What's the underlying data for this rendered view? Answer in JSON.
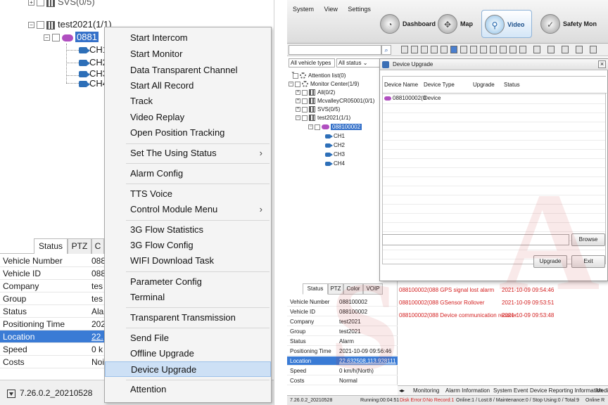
{
  "left": {
    "tree": {
      "top_partial": "SVS(0/5)",
      "group": "test2021(1/1)",
      "device": "0881",
      "channels": [
        "CH1",
        "CH2",
        "CH3",
        "CH4"
      ]
    },
    "context_menu": {
      "items": [
        "Start Intercom",
        "Start Monitor",
        "Data Transparent Channel",
        "Start All Record",
        "Track",
        "Video Replay",
        "Open Position Tracking",
        "Set The Using Status",
        "Alarm Config",
        "TTS Voice",
        "Control Module Menu",
        "3G Flow Statistics",
        "3G Flow Config",
        "WIFI Download Task",
        "Parameter Config",
        "Terminal",
        "Transparent Transmission",
        "Send File",
        "Offline Upgrade",
        "Device Upgrade",
        "Attention"
      ],
      "highlighted": "Device Upgrade",
      "submenu_arrow": "›"
    },
    "status_tabs": [
      "Status",
      "PTZ",
      "C"
    ],
    "status_rows": [
      {
        "k": "Vehicle Number",
        "v": "088"
      },
      {
        "k": "Vehicle ID",
        "v": "088"
      },
      {
        "k": "Company",
        "v": "tes"
      },
      {
        "k": "Group",
        "v": "tes"
      },
      {
        "k": "Status",
        "v": "Ala"
      },
      {
        "k": "Positioning Time",
        "v": "202"
      },
      {
        "k": "Location",
        "v": "22."
      },
      {
        "k": "Speed",
        "v": "0 k"
      },
      {
        "k": "Costs",
        "v": "Noi"
      }
    ],
    "version": "7.26.0.2_20210528"
  },
  "right": {
    "menu": [
      "System",
      "View",
      "Settings"
    ],
    "nav": [
      {
        "label": "Dashboard",
        "icon": "◔"
      },
      {
        "label": "Map",
        "icon": "✥"
      },
      {
        "label": "Video",
        "icon": "⚲"
      },
      {
        "label": "Safety Mon",
        "icon": "✓"
      }
    ],
    "filter": {
      "vehicle_types": "All vehicle types",
      "status": "All status"
    },
    "tree": {
      "items": [
        "Attention list(0)",
        "Monitor Center(1/9)",
        "All(0/2)",
        "McvalleyCR05001(0/1)",
        "SVS(0/5)",
        "test2021(1/1)",
        "088100002",
        "CH1",
        "CH2",
        "CH3",
        "CH4"
      ]
    },
    "dialog": {
      "title": "Device Upgrade",
      "close": "×",
      "columns": [
        "Device Name",
        "Device Type",
        "Upgrade",
        "Status"
      ],
      "row": {
        "name": "088100002(0",
        "type": "Device"
      },
      "browse": "Browse",
      "upgrade": "Upgrade",
      "exit": "Exit"
    },
    "status_tabs": [
      "Status",
      "PTZ",
      "Color",
      "VOIP"
    ],
    "status_rows": [
      {
        "k": "Vehicle Number",
        "v": "088100002"
      },
      {
        "k": "Vehicle ID",
        "v": "088100002"
      },
      {
        "k": "Company",
        "v": "test2021"
      },
      {
        "k": "Group",
        "v": "test2021"
      },
      {
        "k": "Status",
        "v": "Alarm"
      },
      {
        "k": "Positioning Time",
        "v": "2021-10-09 09:56:46"
      },
      {
        "k": "Location",
        "v": "22.632508,113.928111"
      },
      {
        "k": "Speed",
        "v": "0 km/h(North)"
      },
      {
        "k": "Costs",
        "v": "Normal"
      }
    ],
    "alarms": [
      {
        "name": "088100002(088 GPS signal lost alarm",
        "time": "2021-10-09 09:54:46"
      },
      {
        "name": "088100002(088 GSensor Rollover",
        "time": "2021-10-09 09:53:51"
      },
      {
        "name": "088100002(088 Device communication recover",
        "time": "2021-10-09 09:53:48"
      }
    ],
    "bottom_tabs": [
      "Monitoring",
      "Alarm Information",
      "System Event",
      "Device Reporting Information",
      "Media"
    ],
    "statusbar": {
      "version": "7.26.0.2_20210528",
      "running": "Running:00:04:51",
      "disk": "Disk Error:0",
      "record": "No Record:1",
      "counts": "Online:1 / Lost:8 / Maintenance:0 / Stop Using:0 / Total:9",
      "online_rate": "Online R"
    }
  },
  "colors": {
    "selection": "#3a7bd5",
    "alarm_text": "#d32020",
    "menu_highlight": "#cde0f5"
  }
}
